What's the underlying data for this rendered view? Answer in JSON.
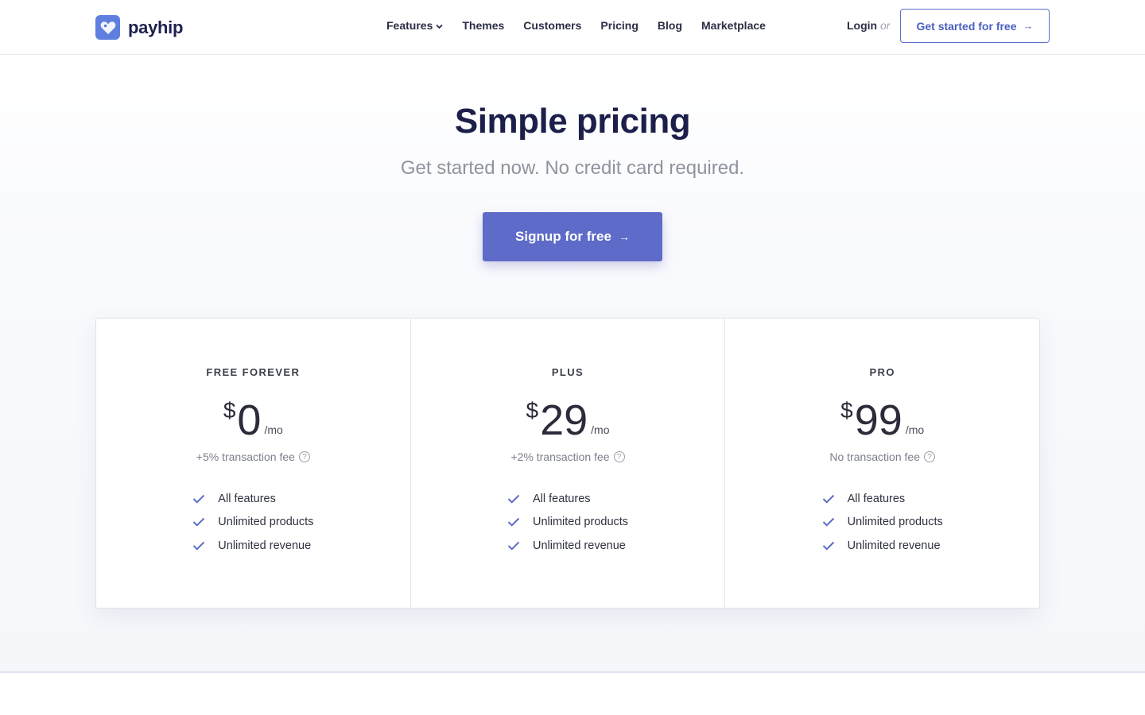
{
  "brand": {
    "name": "payhip",
    "accent": "#5e6bc8"
  },
  "nav": {
    "items": [
      {
        "label": "Features",
        "has_dropdown": true
      },
      {
        "label": "Themes"
      },
      {
        "label": "Customers"
      },
      {
        "label": "Pricing"
      },
      {
        "label": "Blog"
      },
      {
        "label": "Marketplace"
      }
    ],
    "login_label": "Login",
    "or_label": "or",
    "cta_label": "Get started for free",
    "cta_icon": "arrow-right-icon"
  },
  "hero": {
    "title": "Simple pricing",
    "subtitle": "Get started now. No credit card required.",
    "signup_label": "Signup for free",
    "signup_icon": "arrow-right-icon"
  },
  "plans": [
    {
      "name": "FREE FOREVER",
      "currency": "$",
      "amount": "0",
      "period": "/mo",
      "fee": "+5% transaction fee",
      "features": [
        "All features",
        "Unlimited products",
        "Unlimited revenue"
      ]
    },
    {
      "name": "PLUS",
      "currency": "$",
      "amount": "29",
      "period": "/mo",
      "fee": "+2% transaction fee",
      "features": [
        "All features",
        "Unlimited products",
        "Unlimited revenue"
      ]
    },
    {
      "name": "PRO",
      "currency": "$",
      "amount": "99",
      "period": "/mo",
      "fee": "No transaction fee",
      "features": [
        "All features",
        "Unlimited products",
        "Unlimited revenue"
      ]
    }
  ],
  "colors": {
    "heading": "#1c1f4a",
    "check": "#5e6bc8",
    "muted": "#8f939e"
  }
}
